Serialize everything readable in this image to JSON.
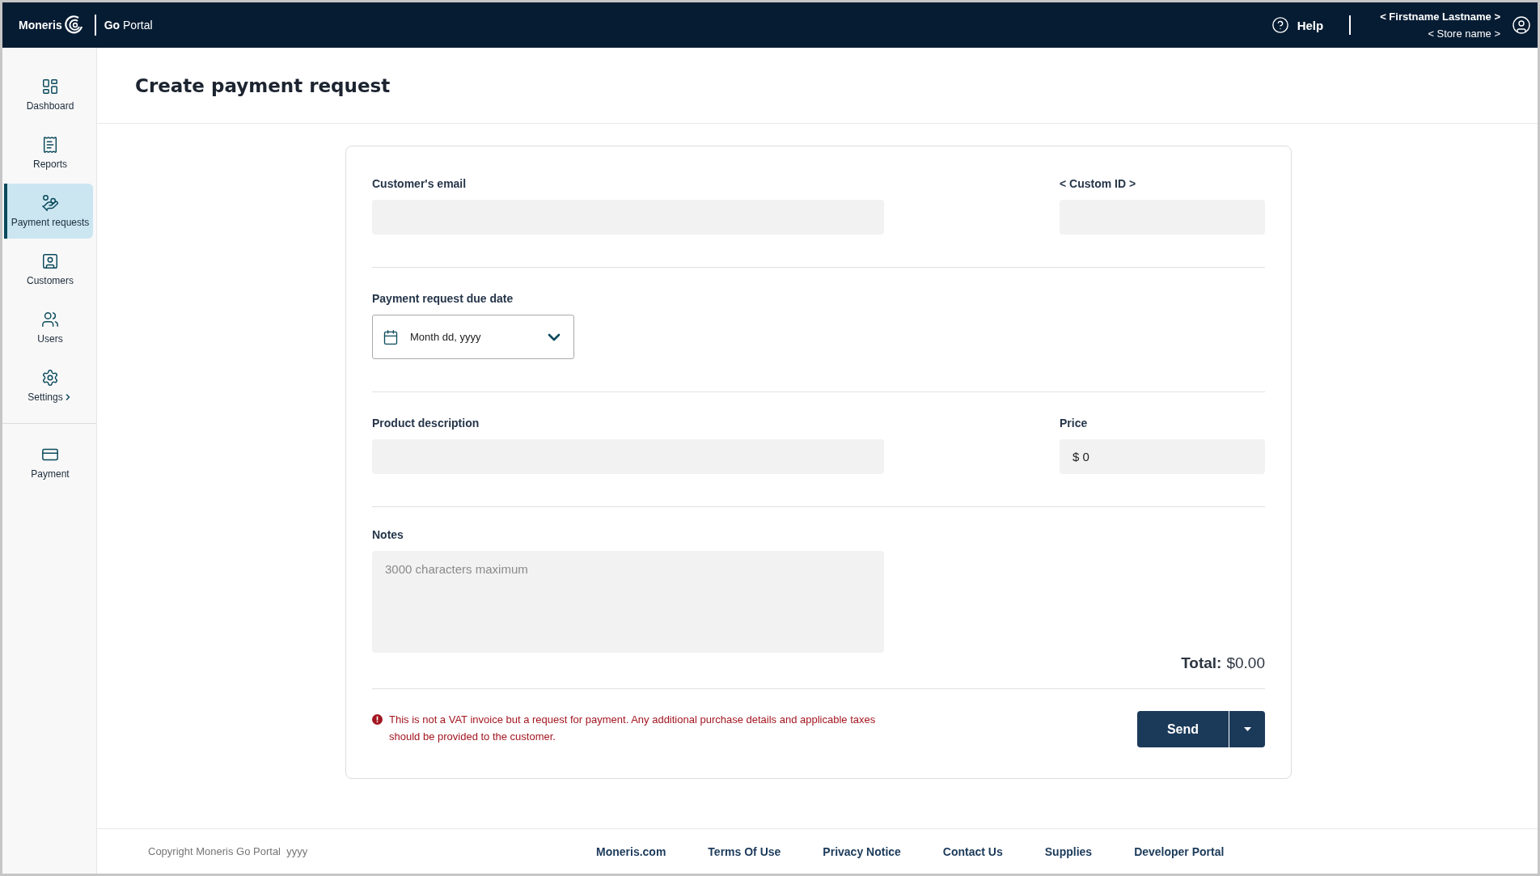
{
  "header": {
    "brand": "Moneris",
    "product": "**Go** Portal",
    "help": "Help",
    "user_name": "< Firstname Lastname >",
    "store_name": "< Store name >"
  },
  "sidebar": {
    "items": [
      {
        "kind": "dashboard",
        "label": "Dashboard",
        "selected": false,
        "has_submenu": false
      },
      {
        "kind": "reports",
        "label": "Reports",
        "selected": false,
        "has_submenu": false
      },
      {
        "kind": "requests",
        "label": "Payment requests",
        "selected": true,
        "has_submenu": false
      },
      {
        "kind": "customers",
        "label": "Customers",
        "selected": false,
        "has_submenu": false
      },
      {
        "kind": "users",
        "label": "Users",
        "selected": false,
        "has_submenu": false
      },
      {
        "kind": "settings",
        "label": "Settings",
        "selected": false,
        "has_submenu": true
      }
    ],
    "secondary_items": [
      {
        "kind": "payment",
        "label": "Payment",
        "selected": false,
        "has_submenu": false
      }
    ]
  },
  "page_title": "Create payment request",
  "form": {
    "email": {
      "label": "Customer's email"
    },
    "custom_id": {
      "label": "< Custom ID >"
    },
    "due_date": {
      "label": "Payment request due date",
      "placeholder": "Month dd, yyyy"
    },
    "product": {
      "label": "Product description"
    },
    "price": {
      "label": "Price",
      "value": "$ 0"
    },
    "notes": {
      "label": "Notes",
      "placeholder": "3000 characters maximum"
    },
    "total_label": "Total:",
    "total_value": "$0.00",
    "notice": "This is not a VAT invoice but a request for payment. Any additional purchase details and applicable taxes should be provided to the customer.",
    "send": "Send"
  },
  "footer": {
    "copyright": "Copyright Moneris Go Portal  yyyy",
    "links": [
      "Moneris.com",
      "Terms Of Use",
      "Privacy Notice",
      "Contact Us",
      "Supplies",
      "Developer Portal"
    ]
  }
}
